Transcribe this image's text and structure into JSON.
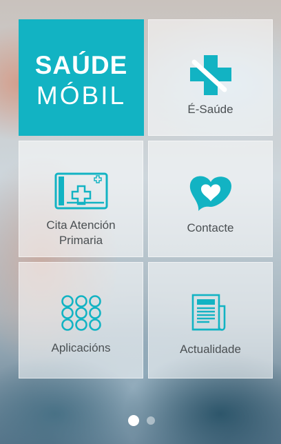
{
  "app": {
    "logo_line1": "SAÚDE",
    "logo_line2": "MÓBIL",
    "accent_color": "#12b3c3"
  },
  "tiles": [
    {
      "label": "É-Saúde",
      "icon": "medical-cross-icon"
    },
    {
      "label": "Cita Atención\nPrimaria",
      "icon": "health-card-icon"
    },
    {
      "label": "Contacte",
      "icon": "heart-speech-bubble-icon"
    },
    {
      "label": "Aplicacións",
      "icon": "apps-grid-icon"
    },
    {
      "label": "Actualidade",
      "icon": "newspaper-icon"
    }
  ],
  "pager": {
    "pages": 2,
    "current": 1
  }
}
